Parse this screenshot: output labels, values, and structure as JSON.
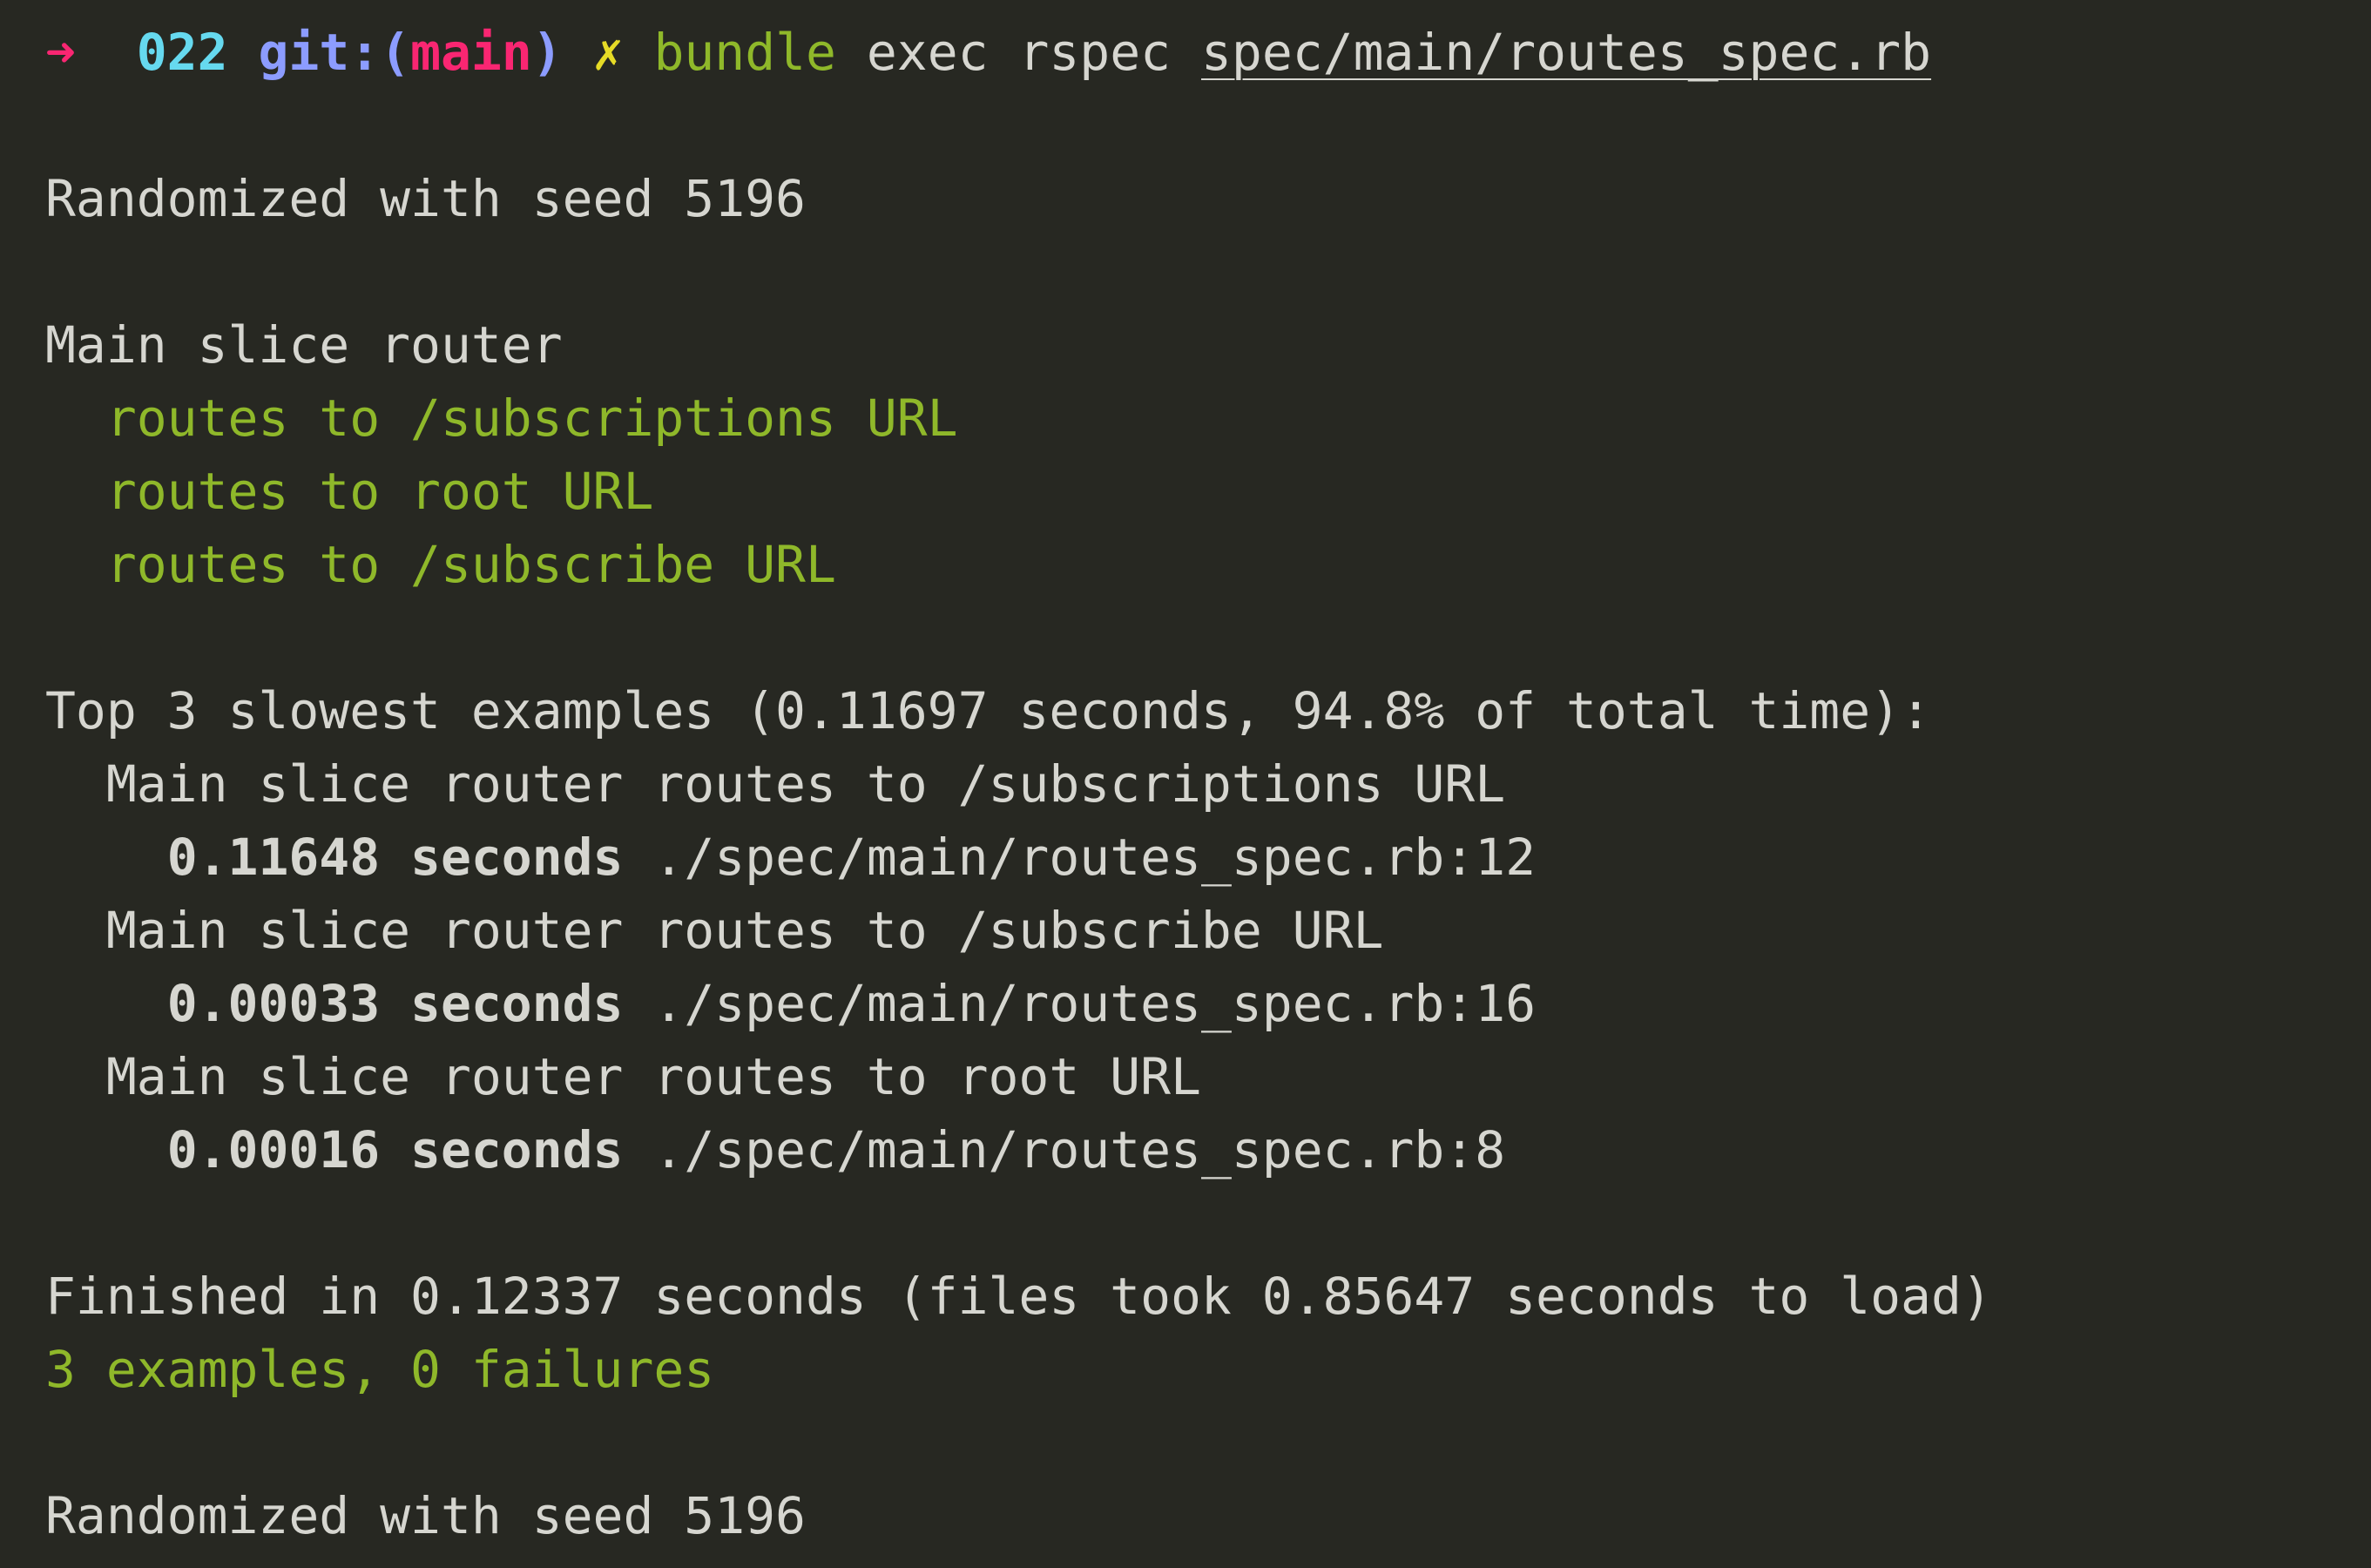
{
  "prompt": {
    "arrow": "➜",
    "dir": "022",
    "git_label": "git:(",
    "branch": "main",
    "git_close": ")",
    "dirty": "✗",
    "command": "bundle",
    "args": "exec rspec",
    "file": "spec/main/routes_spec.rb"
  },
  "colors": {
    "background": "#272822",
    "green": "#8fb82a",
    "pink": "#f92672",
    "cyan": "#66d9ef",
    "yellow": "#e6db26"
  },
  "output": {
    "seed_line": "Randomized with seed 5196",
    "group": "Main slice router",
    "examples": [
      "routes to /subscriptions URL",
      "routes to root URL",
      "routes to /subscribe URL"
    ],
    "slowest_header": "Top 3 slowest examples (0.11697 seconds, 94.8% of total time):",
    "slowest": [
      {
        "name": "Main slice router routes to /subscriptions URL",
        "time": "0.11648 seconds",
        "loc": "./spec/main/routes_spec.rb:12"
      },
      {
        "name": "Main slice router routes to /subscribe URL",
        "time": "0.00033 seconds",
        "loc": "./spec/main/routes_spec.rb:16"
      },
      {
        "name": "Main slice router routes to root URL",
        "time": "0.00016 seconds",
        "loc": "./spec/main/routes_spec.rb:8"
      }
    ],
    "finished": "Finished in 0.12337 seconds (files took 0.85647 seconds to load)",
    "summary": "3 examples, 0 failures",
    "seed_line_end": "Randomized with seed 5196"
  }
}
